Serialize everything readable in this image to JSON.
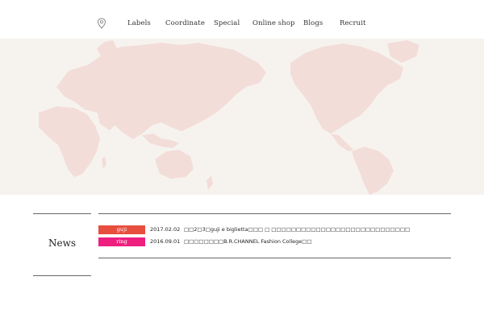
{
  "nav": {
    "items": [
      {
        "label": "Labels"
      },
      {
        "label": "Coordinate"
      },
      {
        "label": "Special"
      },
      {
        "label": "Online shop"
      },
      {
        "label": "Blogs"
      },
      {
        "label": "Recruit"
      }
    ],
    "icon": "map-pin-icon"
  },
  "hero": {
    "map_color": "#f3ddd8",
    "background": "#f6f3ef"
  },
  "news": {
    "heading": "News",
    "items": [
      {
        "badge": "guji",
        "badge_color": "#e84e3e",
        "date": "2017.02.02",
        "title": "□□2□3□guji e biglietta□□□ □ □□□□□□□□□□□□□□□□□□□□□□□□□□□□"
      },
      {
        "badge": "ring",
        "badge_color": "#ee1f7f",
        "date": "2016.09.01",
        "title": "□□□□□□□□B.R.CHANNEL Fashion College□□"
      }
    ]
  }
}
